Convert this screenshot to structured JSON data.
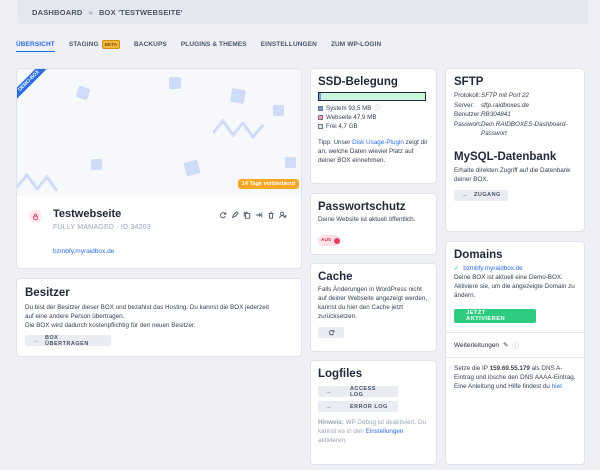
{
  "breadcrumb": {
    "root": "DASHBOARD",
    "separator": "»",
    "current": "BOX 'TESTWEBSEITE'"
  },
  "tabs": [
    {
      "label": "ÜBERSICHT",
      "active": true
    },
    {
      "label": "STAGING",
      "badge": "BETA"
    },
    {
      "label": "BACKUPS"
    },
    {
      "label": "PLUGINS & THEMES"
    },
    {
      "label": "EINSTELLUNGEN"
    },
    {
      "label": "ZUM WP-LOGIN"
    }
  ],
  "box": {
    "ribbon": "DEMO-BOX",
    "trial_badge": "14 Tage verbleibend",
    "name": "Testwebseite",
    "subtitle": "FULLY MANAGED · ID 34203",
    "url": "bzmbfy.myraidbox.de"
  },
  "owner": {
    "title": "Besitzer",
    "lines": [
      "Du bist der Besitzer dieser BOX und bezahlst das Hosting. Du kannst die BOX jederzeit",
      "auf eine andere Person übertragen.",
      "Die BOX wird dadurch kostenpflichtig für den neuen Besitzer."
    ],
    "button": "BOX ÜBERTRAGEN"
  },
  "ssd": {
    "title": "SSD-Belegung",
    "used_fraction": 0.02,
    "legend": [
      {
        "label": "System 93,5 MB",
        "color": "#6f9de8"
      },
      {
        "label": "Webseite 47,9 MB",
        "color": "#f4a0b0"
      },
      {
        "label": "Frei 4,7 GB",
        "color": "#ccf5dd"
      }
    ],
    "tip_prefix": "Tipp: Unser ",
    "tip_link": "Disk Usage-Plugin",
    "tip_suffix": " zeigt dir an, welche Daten wieviel Platz auf deiner BOX einnehmen."
  },
  "password": {
    "title": "Passwortschutz",
    "text": "Deine Website ist aktuell öffentlich.",
    "toggle": "AUS"
  },
  "cache": {
    "title": "Cache",
    "text": "Falls Änderungen in WordPress nicht auf deiner Webseite angezeigt werden, kannst du hier den Cache jetzt zurücksetzen."
  },
  "logfiles": {
    "title": "Logfiles",
    "access": "ACCESS LOG",
    "error": "ERROR LOG",
    "hint_bold": "Hinweis:",
    "hint_text": " WP Debug ist deaktiviert. Du kannst es in den ",
    "hint_link": "Einstellungen",
    "hint_end": " aktivieren."
  },
  "sftp": {
    "title": "SFTP",
    "rows": [
      {
        "k": "Protokoll:",
        "v": "SFTP mit Port 22"
      },
      {
        "k": "Server:",
        "v": "sftp.raidboxes.de"
      },
      {
        "k": "Benutzer:",
        "v": "RB304841"
      },
      {
        "k": "Passwort:",
        "v": "Dein RAIDBOXES-Dashboard-Passwort"
      }
    ]
  },
  "mysql": {
    "title": "MySQL-Datenbank",
    "text": "Erhalte direkten Zugriff auf die Datenbank deiner BOX.",
    "button": "ZUGANG"
  },
  "domains": {
    "title": "Domains",
    "domain": "bzmbfy.myraidbox.de",
    "text": "Deine BOX ist aktuell eine Demo-BOX. Aktiviere sie, um die angezeigte Domain zu ändern.",
    "button": "JETZT AKTIVIEREN",
    "redirects_label": "Weiterleitungen",
    "ip_prefix": "Setze die IP ",
    "ip": "159.69.55.179",
    "ip_suffix": " als DNS A-Eintrag und lösche den DNS AAAA-Eintrag. Eine Anleitung und Hilfe findest du ",
    "ip_link": "hier",
    "ip_end": "."
  }
}
